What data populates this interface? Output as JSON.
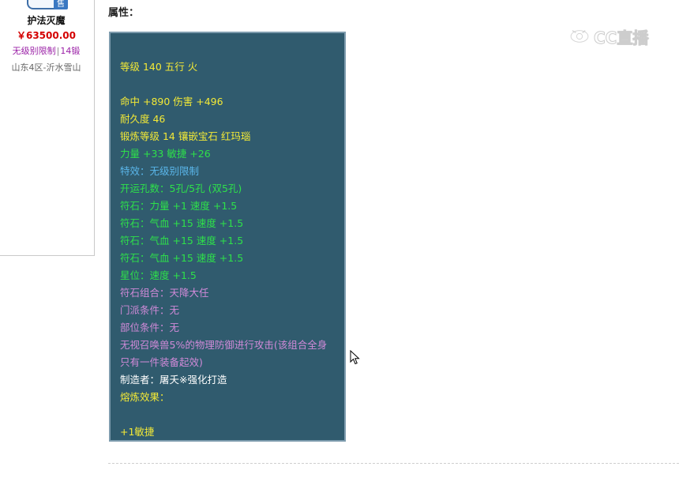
{
  "item": {
    "sale_tag": "售",
    "name": "护法灭魔",
    "price": "￥63500.00",
    "tag_level": "无级别限制",
    "tag_sep": "|",
    "tag_forge": "14锻",
    "server": "山东4区-沂水雪山"
  },
  "attributes": {
    "heading": "属性：",
    "lines": [
      {
        "text": "",
        "color": "blank"
      },
      {
        "text": "等级 140 五行 火",
        "color": "yellow"
      },
      {
        "text": "",
        "color": "blank"
      },
      {
        "text": "命中 +890 伤害 +496",
        "color": "yellow"
      },
      {
        "text": "耐久度 46",
        "color": "yellow"
      },
      {
        "text": "锻炼等级 14 镶嵌宝石 红玛瑙",
        "color": "yellow"
      },
      {
        "text": "力量 +33 敏捷 +26",
        "color": "green"
      },
      {
        "text": "特效：无级别限制",
        "color": "blue"
      },
      {
        "text": "开运孔数：5孔/5孔 (双5孔)",
        "color": "green"
      },
      {
        "text": "符石：力量 +1 速度 +1.5",
        "color": "green"
      },
      {
        "text": "符石：气血 +15 速度 +1.5",
        "color": "green"
      },
      {
        "text": "符石：气血 +15 速度 +1.5",
        "color": "green"
      },
      {
        "text": "符石：气血 +15 速度 +1.5",
        "color": "green"
      },
      {
        "text": "星位：速度 +1.5",
        "color": "green"
      },
      {
        "text": "符石组合：天降大任",
        "color": "purple"
      },
      {
        "text": "门派条件：无",
        "color": "purple"
      },
      {
        "text": "部位条件：无",
        "color": "purple"
      },
      {
        "text": "无视召唤兽5%的物理防御进行攻击(该组合全身只有一件装备起效)",
        "color": "purple"
      },
      {
        "text": "制造者：屠夭※强化打造",
        "color": "white"
      },
      {
        "text": "熔炼效果：",
        "color": "yellow"
      },
      {
        "text": "",
        "color": "blank"
      },
      {
        "text": "+1敏捷",
        "color": "yellow"
      }
    ]
  },
  "watermark": {
    "text": "CC直播"
  },
  "colors": {
    "tooltip_bg": "#305b6e",
    "yellow": "#f3e936",
    "green": "#2ee14a",
    "blue": "#5ab6ea",
    "purple": "#d08ad8",
    "price_red": "#d40000"
  }
}
